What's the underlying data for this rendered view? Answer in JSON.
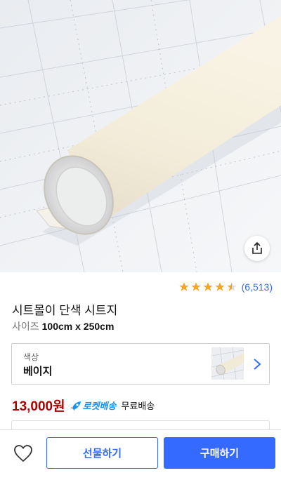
{
  "product": {
    "image_alt_icon": "sheet-roll-image",
    "rating": 4.5,
    "review_count": "(6,513)",
    "title": "시트몰이 단색 시트지",
    "size_label": "사이즈",
    "size_value": "100cm x 250cm"
  },
  "option": {
    "label": "색상",
    "value": "베이지"
  },
  "price": {
    "amount": "13,000원",
    "rocket_label": "로켓배송",
    "shipping": "무료배송"
  },
  "actions": {
    "gift_label": "선물하기",
    "buy_label": "구매하기"
  },
  "colors": {
    "accent": "#346aff",
    "price": "#ae0000",
    "star": "#f5a623",
    "rocket": "#1991f0"
  }
}
